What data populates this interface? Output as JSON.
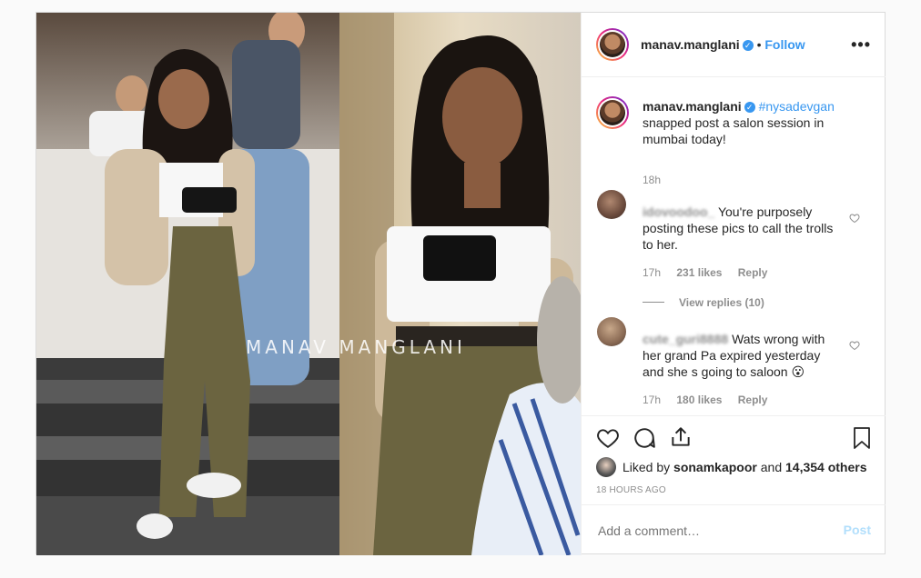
{
  "post": {
    "author": "manav.manglani",
    "follow_label": "Follow",
    "dot": "•",
    "more_label": "•••",
    "caption_tag": "#nysadevgan",
    "caption_text": "snapped post a salon session in mumbai today!",
    "caption_time": "18h",
    "watermark": "MANAV MANGLANI"
  },
  "comments": [
    {
      "user": "idovoodoo_",
      "text": "You're purposely posting these pics to call the trolls to her.",
      "time": "17h",
      "likes": "231 likes",
      "reply": "Reply",
      "view_replies": "View replies (10)"
    },
    {
      "user": "cute_guri8888",
      "text": "Wats wrong with her grand Pa expired yesterday and she s going to saloon 😮",
      "time": "17h",
      "likes": "180 likes",
      "reply": "Reply"
    }
  ],
  "likes": {
    "prefix": "Liked by",
    "user": "sonamkapoor",
    "and": "and",
    "others": "14,354 others"
  },
  "timestamp": "18 HOURS AGO",
  "add_comment": {
    "placeholder": "Add a comment…",
    "post_label": "Post"
  },
  "colors": {
    "accent": "#3897f0",
    "muted": "#8e8e8e",
    "border": "#dbdbdb"
  },
  "icons": [
    "heart-icon",
    "comment-icon",
    "share-icon",
    "bookmark-icon",
    "verified-icon",
    "more-icon"
  ]
}
